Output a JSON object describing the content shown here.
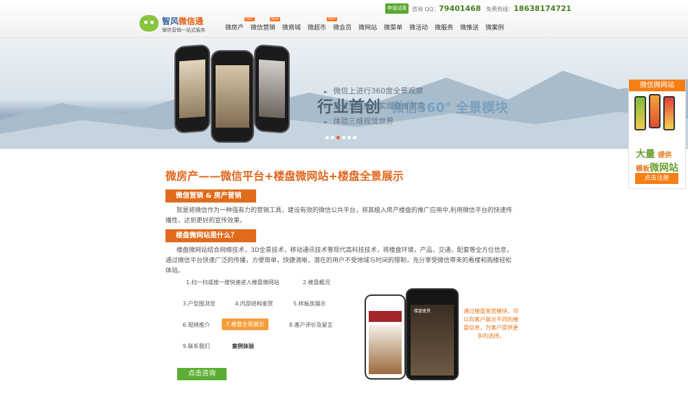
{
  "header": {
    "logo_title_a": "智风",
    "logo_title_b": "微信通",
    "logo_sub": "微信营销一站式服务",
    "trial_label": "申请试用",
    "qq_label": "咨询 QQ：",
    "qq": "79401468",
    "hotline_label": "免费热线：",
    "hotline": "18638174721",
    "nav": [
      {
        "label": "微房产",
        "tag": "HOT"
      },
      {
        "label": "微信营销",
        "tag": "New"
      },
      {
        "label": "微商城",
        "tag": ""
      },
      {
        "label": "微超市",
        "tag": "HOT"
      },
      {
        "label": "微会员",
        "tag": ""
      },
      {
        "label": "微网站",
        "tag": ""
      },
      {
        "label": "微菜单",
        "tag": ""
      },
      {
        "label": "微活动",
        "tag": ""
      },
      {
        "label": "微服务",
        "tag": ""
      },
      {
        "label": "微推送",
        "tag": ""
      },
      {
        "label": "微案例",
        "tag": ""
      }
    ]
  },
  "banner": {
    "title": "行业首创",
    "title_sub": "微信360° 全景模块",
    "features": [
      "微信上进行360度全景观察",
      "通过交互操作实现自由浏览",
      "体验三维视觉世界"
    ],
    "active_dot": 2
  },
  "sidebar": {
    "header": "微信微网站",
    "big_a": "大量",
    "big_b": "提供",
    "big_c": "模板",
    "big_d": "微网站",
    "register": "点击注册"
  },
  "main": {
    "title": "微房产——微信平台+楼盘微网站+楼盘全景展示",
    "section1": "微信营销 & 房产营销",
    "para1": "就是将微信作为一种强有力的营销工具，建设有效的微信公共平台，将其植入房产楼盘的推广应用中,利用微信平台的快速传播性，达到更好的宣传效果。",
    "section2": "楼盘微网站是什么？",
    "para2": "楼盘微网站结合网络技术，3D全景技术，移动通讯技术等现代高科技技术，将楼盘环境，产品，交通，配套等全方位信息，通过微信平台快速广泛的传播，方便简单，快捷清晰，潜在的用户不受地域与时间的限制，充分享受微信带来的看楼和购楼轻松体验。",
    "tabs": [
      "1.扫一扫或搜一搜快速进入楼盘微网站",
      "2.楼盘概况",
      "3.户型图浏览",
      "4.内部结构鉴赏",
      "5.样板房展示",
      "6.视频推介",
      "7.楼盘全景展示",
      "8.客户评价及留言",
      "9.联系我们",
      "案例体验"
    ],
    "consult": "点击咨询",
    "note": "通过楼盘鉴赏模块，可以向客户展示不同的楼盘信息，为客户提供更多的选择。",
    "phone_brand": "楼盘鉴赏"
  }
}
